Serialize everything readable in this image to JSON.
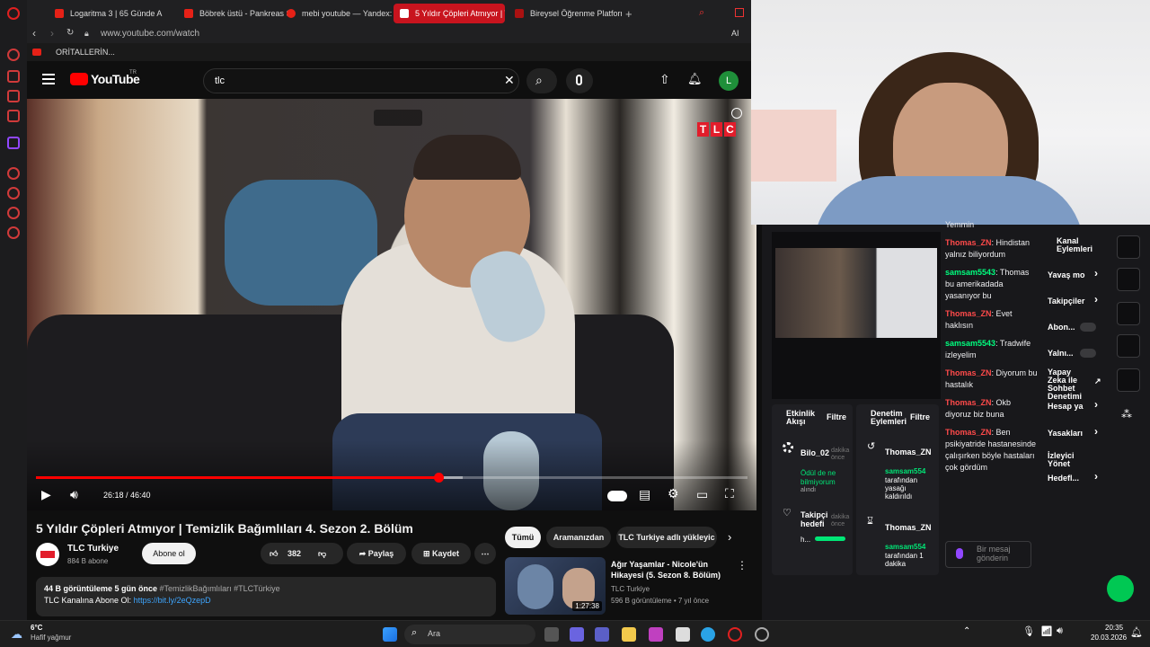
{
  "browser": {
    "tabs": [
      {
        "label": "Logaritma 3 | 65 Günde A",
        "active": false
      },
      {
        "label": "Böbrek üstü - Pankreas Sı",
        "active": false
      },
      {
        "label": "mebi youtube — Yandex:",
        "active": false
      },
      {
        "label": "5 Yıldır Çöpleri Atmıyor | T",
        "active": true
      },
      {
        "label": "Bireysel Öğrenme Platform",
        "active": false
      }
    ],
    "url": "www.youtube.com/watch",
    "bookmark_label": "ORİTALLERİN...",
    "ai_label": "AI",
    "accent": "#c8141e"
  },
  "youtube": {
    "logo_text": "YouTube",
    "country": "TR",
    "search_value": "tlc",
    "avatar_letter": "L",
    "video": {
      "watermark": [
        "T",
        "L",
        "C"
      ],
      "time": "26:18 / 46:40",
      "progress_fraction": 0.5652,
      "buffered_fraction": 0.6
    },
    "title": "5 Yıldır Çöpleri Atmıyor | Temizlik Bağımlıları 4. Sezon 2. Bölüm",
    "channel": {
      "name": "TLC Turkiye",
      "subscribers": "884 B abone",
      "subscribe_label": "Abone ol"
    },
    "actions": {
      "likes": "382",
      "share_label": "Paylaş",
      "save_label": "Kaydet"
    },
    "description": {
      "stats": "44 B görüntüleme  5 gün önce",
      "hashtags": "#TemizlikBağımlıları #TLCTürkiye",
      "line2": "TLC Kanalına Abone Ol: ",
      "link": "https://bit.ly/2eQzepD"
    },
    "chips": [
      "Tümü",
      "Aramanızdan",
      "TLC Turkiye adlı yükleyic"
    ],
    "recommendation": {
      "title": "Ağır Yaşamlar - Nicole'ün Hikayesi (5. Sezon 8. Bölüm)",
      "channel": "TLC Turkiye",
      "meta": "596 B görüntüleme • 7 yıl önce",
      "duration": "1:27:38"
    }
  },
  "stream": {
    "chat": [
      {
        "user": "",
        "text": "Yemmin",
        "color": "#efeff1"
      },
      {
        "user": "Thomas_ZN",
        "text": "Hindistan yalnız biliyordum",
        "color": "#ff4a4a"
      },
      {
        "user": "samsam5543",
        "text": "Thomas bu amerikadada yasanıyor bu",
        "color": "#00ff7f"
      },
      {
        "user": "Thomas_ZN",
        "text": "Evet haklısın",
        "color": "#ff4a4a"
      },
      {
        "user": "samsam5543",
        "text": "Tradwife izleyelim",
        "color": "#00ff7f"
      },
      {
        "user": "Thomas_ZN",
        "text": "Diyorum bu hastalık",
        "color": "#ff4a4a"
      },
      {
        "user": "Thomas_ZN",
        "text": "Okb diyoruz biz buna",
        "color": "#ff4a4a"
      },
      {
        "user": "Thomas_ZN",
        "text": "Ben psikiyatride hastanesinde çalışırken böyle hastaları çok gördüm",
        "color": "#ff4a4a"
      }
    ],
    "chat_placeholder": "Bir mesaj gönderin",
    "activity": {
      "title": "Etkinlik Akışı",
      "filter": "Filtre",
      "item_user": "Bilo_02",
      "item_time": "dakika önce",
      "item_text": "Ödül de ne bilmiyorum",
      "item_note": "alındı",
      "goal_title": "Takipçi hedefi",
      "goal_time": "dakika önce",
      "goal_text": "h..."
    },
    "mod": {
      "title": "Denetim Eylemleri",
      "filter": "Filtre",
      "user1": "Thomas_ZN",
      "action1_by": "samsam554",
      "action1_text": "tarafından yasağı kaldırıldı",
      "user2": "Thomas_ZN",
      "action2_by": "samsam554",
      "action2_text": "tarafından 1 dakika"
    },
    "channel_actions": {
      "title": "Kanal Eylemleri",
      "items": [
        {
          "label": "Yavaş mo",
          "type": "arrow"
        },
        {
          "label": "Takipçiler",
          "type": "arrow"
        },
        {
          "label": "Abon...",
          "type": "toggle"
        },
        {
          "label": "Yalnı...",
          "type": "toggle"
        },
        {
          "label": "Yapay Zeka ile Sohbet Denetimi",
          "type": "link"
        },
        {
          "label": "Hesap ya",
          "type": "arrow"
        },
        {
          "label": "Yasakları",
          "type": "arrow"
        },
        {
          "label": "İzleyici Yönet",
          "type": "none"
        },
        {
          "label": "Hedefl...",
          "type": "arrow"
        }
      ]
    }
  },
  "taskbar": {
    "temperature": "6°C",
    "weather": "Hafif yağmur",
    "search_label": "Ara",
    "time": "20:35",
    "date": "20.03.2026"
  }
}
